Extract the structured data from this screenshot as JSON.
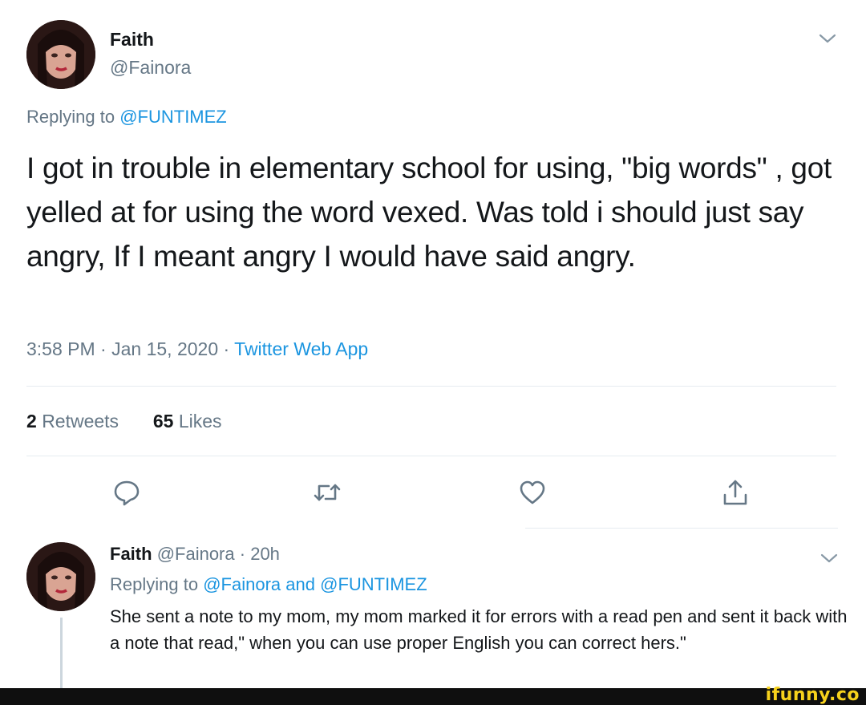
{
  "tweet": {
    "name": "Faith",
    "handle": "@Fainora",
    "replying_prefix": "Replying to",
    "replying_to": "@FUNTIMEZ",
    "text": "I got in trouble in elementary school for using, \"big words\" , got yelled at for using the word vexed. Was told i should just say angry, If I meant angry  I would have said angry.",
    "time": "3:58 PM",
    "date": "Jan 15, 2020",
    "source": "Twitter Web App",
    "sep": "·",
    "retweets_count": "2",
    "retweets_label": "Retweets",
    "likes_count": "65",
    "likes_label": "Likes",
    "icons": [
      "reply-icon",
      "retweet-icon",
      "like-icon",
      "share-icon",
      "chevron-down-icon"
    ]
  },
  "reply": {
    "name": "Faith",
    "handle": "@Fainora",
    "sep": "·",
    "age": "20h",
    "replying_prefix": "Replying to",
    "replying_to_1": "@Fainora",
    "and": "and",
    "replying_to_2": "@FUNTIMEZ",
    "text": "She sent a note to my mom, my mom marked it for errors with a read pen and sent it back with a note that read,\" when you can use proper English you can correct hers.\""
  },
  "footer": {
    "brand": "ifunny.co"
  },
  "colors": {
    "link": "#1b95e0",
    "secondary_text": "#657786",
    "primary_text": "#14171a",
    "divider": "#e6ecf0",
    "brand": "#f7d21c"
  }
}
